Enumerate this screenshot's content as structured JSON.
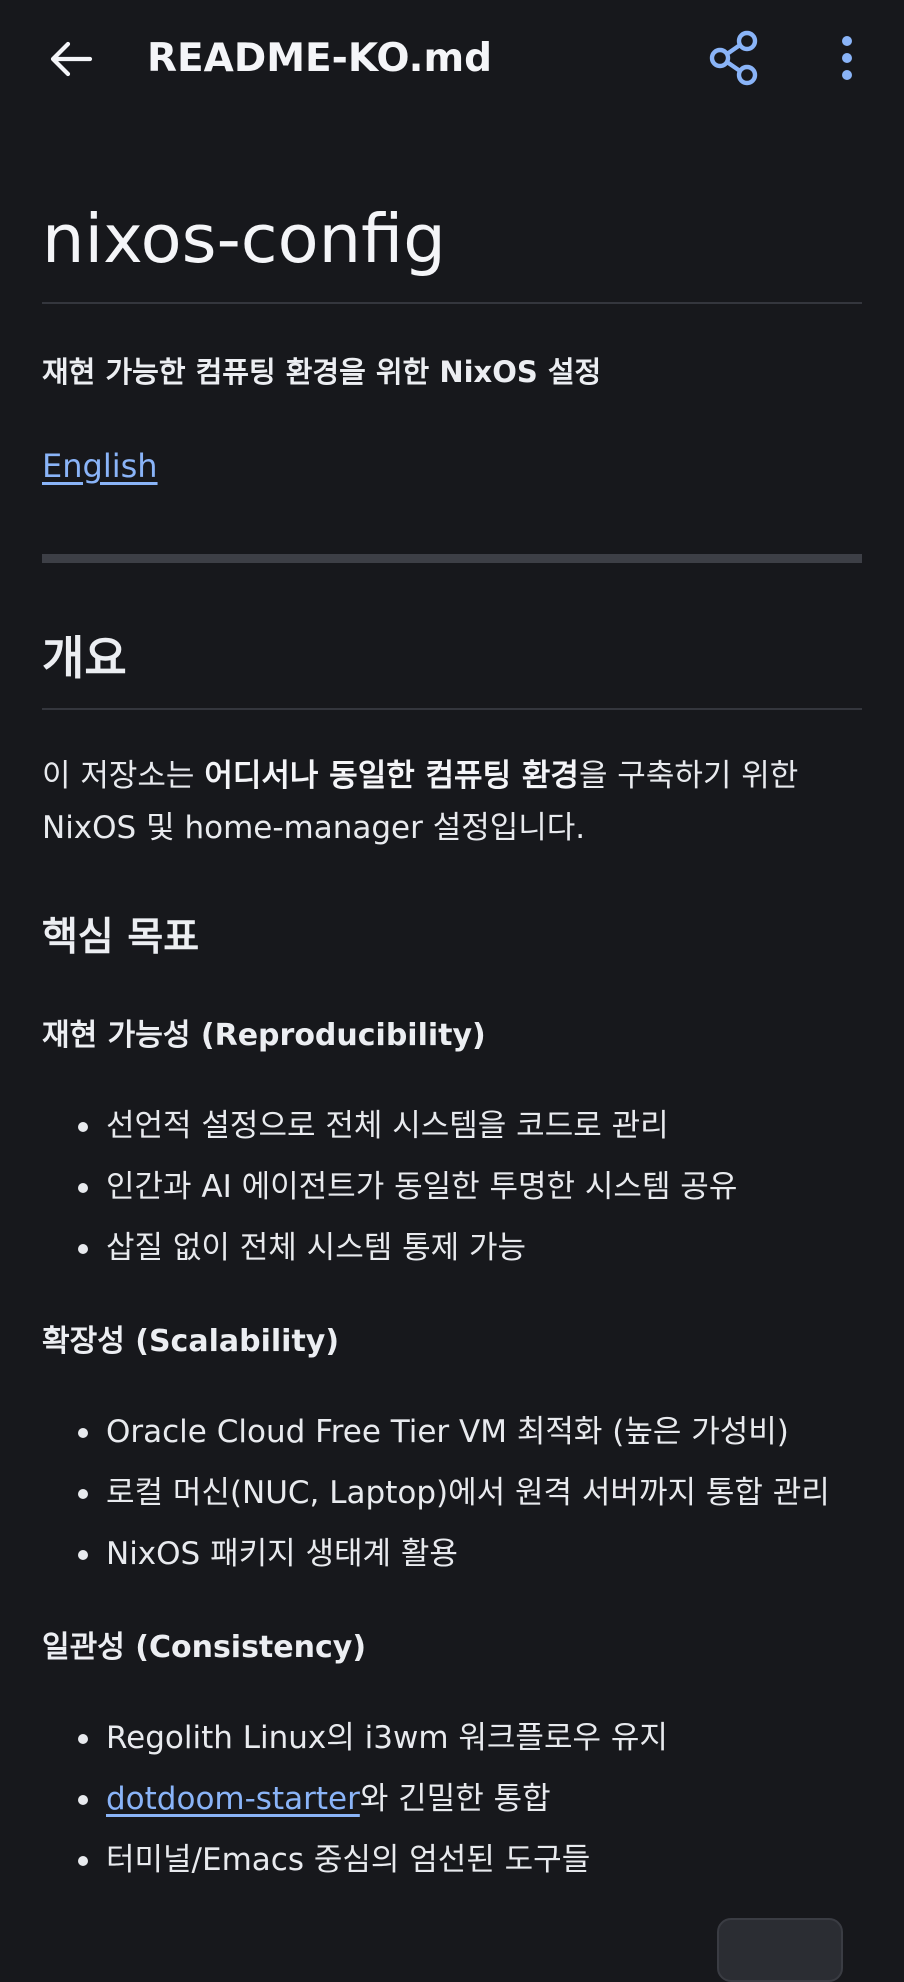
{
  "appbar": {
    "title": "README-KO.md",
    "back_icon": "arrow-left-icon",
    "share_icon": "share-icon",
    "more_icon": "more-vertical-icon"
  },
  "doc": {
    "h1": "nixos-config",
    "subtitle": "재현 가능한 컴퓨팅 환경을 위한 NixOS 설정",
    "lang_link": "English",
    "overview_heading": "개요",
    "overview_para": {
      "pre": "이 저장소는 ",
      "bold": "어디서나 동일한 컴퓨팅 환경",
      "post": "을 구축하기 위한 NixOS 및 home-manager 설정입니다."
    },
    "goals_heading": "핵심 목표",
    "sections": [
      {
        "heading": "재현 가능성 (Reproducibility)",
        "items": [
          "선언적 설정으로 전체 시스템을 코드로 관리",
          "인간과 AI 에이전트가 동일한 투명한 시스템 공유",
          "삽질 없이 전체 시스템 통제 가능"
        ]
      },
      {
        "heading": "확장성 (Scalability)",
        "items": [
          "Oracle Cloud Free Tier VM 최적화 (높은 가성비)",
          "로컬 머신(NUC, Laptop)에서 원격 서버까지 통합 관리",
          "NixOS 패키지 생태계 활용"
        ]
      },
      {
        "heading": "일관성 (Consistency)",
        "items": [
          "Regolith Linux의 i3wm 워크플로우 유지",
          {
            "link": "dotdoom-starter",
            "text": "와 긴밀한 통합"
          },
          "터미널/Emacs 중심의 엄선된 도구들"
        ]
      }
    ]
  },
  "colors": {
    "background": "#17181c",
    "text": "#eceef2",
    "link": "#8ab4f8",
    "accent_icon": "#8ab4f8",
    "divider": "#34363d"
  }
}
